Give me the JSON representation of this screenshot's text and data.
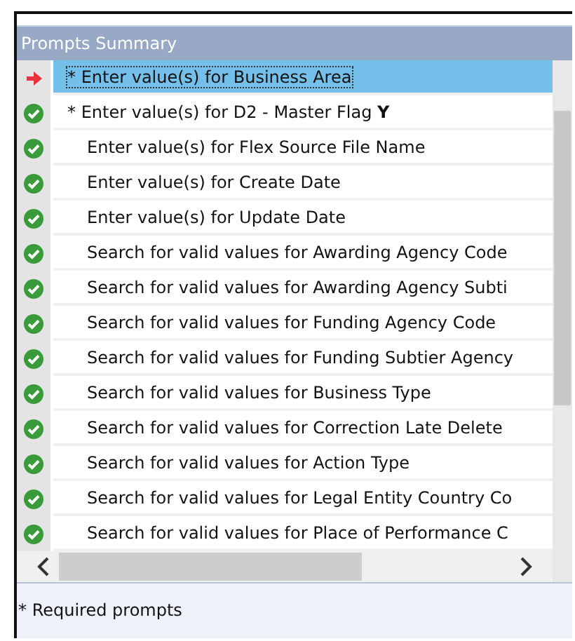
{
  "panel": {
    "title": "Prompts Summary"
  },
  "prompts": [
    {
      "kind": "current",
      "required": true,
      "selected": true,
      "text": "* Enter value(s) for Business Area"
    },
    {
      "kind": "done",
      "required": true,
      "selected": false,
      "text": "* Enter value(s) for D2 - Master Flag **Y**"
    },
    {
      "kind": "done",
      "required": false,
      "selected": false,
      "text": "Enter value(s) for Flex Source File Name"
    },
    {
      "kind": "done",
      "required": false,
      "selected": false,
      "text": "Enter value(s) for Create Date"
    },
    {
      "kind": "done",
      "required": false,
      "selected": false,
      "text": "Enter value(s) for Update Date"
    },
    {
      "kind": "done",
      "required": false,
      "selected": false,
      "text": "Search for valid values for Awarding Agency Code"
    },
    {
      "kind": "done",
      "required": false,
      "selected": false,
      "text": "Search for valid values for Awarding Agency Subti"
    },
    {
      "kind": "done",
      "required": false,
      "selected": false,
      "text": "Search for valid values for Funding Agency Code"
    },
    {
      "kind": "done",
      "required": false,
      "selected": false,
      "text": "Search for valid values for Funding Subtier Agency"
    },
    {
      "kind": "done",
      "required": false,
      "selected": false,
      "text": "Search for valid values for Business Type"
    },
    {
      "kind": "done",
      "required": false,
      "selected": false,
      "text": "Search for valid values for Correction Late Delete"
    },
    {
      "kind": "done",
      "required": false,
      "selected": false,
      "text": "Search for valid values for Action Type"
    },
    {
      "kind": "done",
      "required": false,
      "selected": false,
      "text": "Search for valid values for Legal Entity Country Co"
    },
    {
      "kind": "done",
      "required": false,
      "selected": false,
      "text": "Search for valid values for Place of Performance C"
    }
  ],
  "footer": {
    "note": "* Required prompts"
  }
}
